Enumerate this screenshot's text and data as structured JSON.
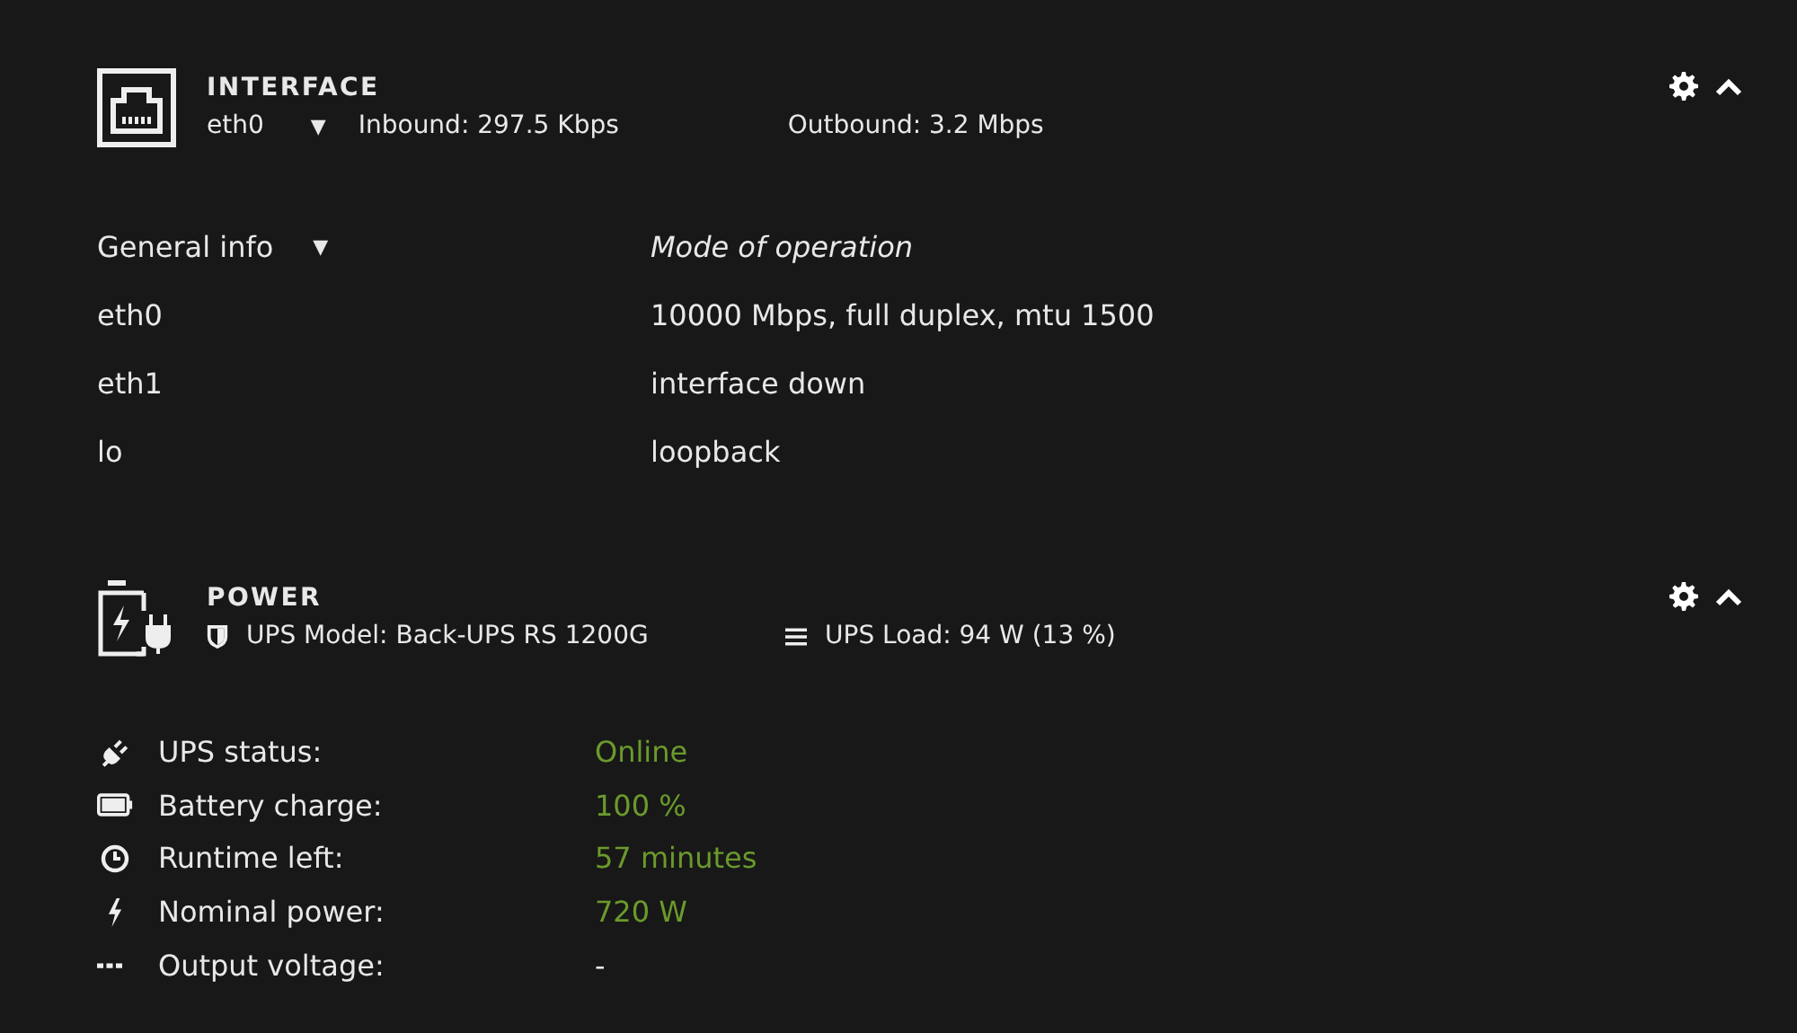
{
  "interface": {
    "title": "INTERFACE",
    "selected_interface": "eth0",
    "caret": "▼",
    "inbound": "Inbound: 297.5 Kbps",
    "outbound": "Outbound: 3.2 Mbps",
    "table": {
      "columns": [
        "General info",
        "Mode of operation"
      ],
      "caret": "▼",
      "rows": [
        {
          "name": "eth0",
          "mode": "10000 Mbps, full duplex, mtu 1500"
        },
        {
          "name": "eth1",
          "mode": "interface down"
        },
        {
          "name": "lo",
          "mode": "loopback"
        }
      ]
    }
  },
  "power": {
    "title": "POWER",
    "model": "UPS Model: Back-UPS RS 1200G",
    "load": "UPS Load: 94 W (13 %)",
    "rows": [
      {
        "kind": "plug",
        "label": "UPS status:",
        "value": "Online",
        "color": "#6b9a2c"
      },
      {
        "kind": "battery",
        "label": "Battery charge:",
        "value": "100 %",
        "color": "#6b9a2c"
      },
      {
        "kind": "clock",
        "label": "Runtime left:",
        "value": "57 minutes",
        "color": "#6b9a2c"
      },
      {
        "kind": "bolt",
        "label": "Nominal power:",
        "value": "720 W",
        "color": "#6b9a2c"
      },
      {
        "kind": "dots",
        "label": "Output voltage:",
        "value": "-",
        "color": "#e8e8e8"
      }
    ]
  }
}
